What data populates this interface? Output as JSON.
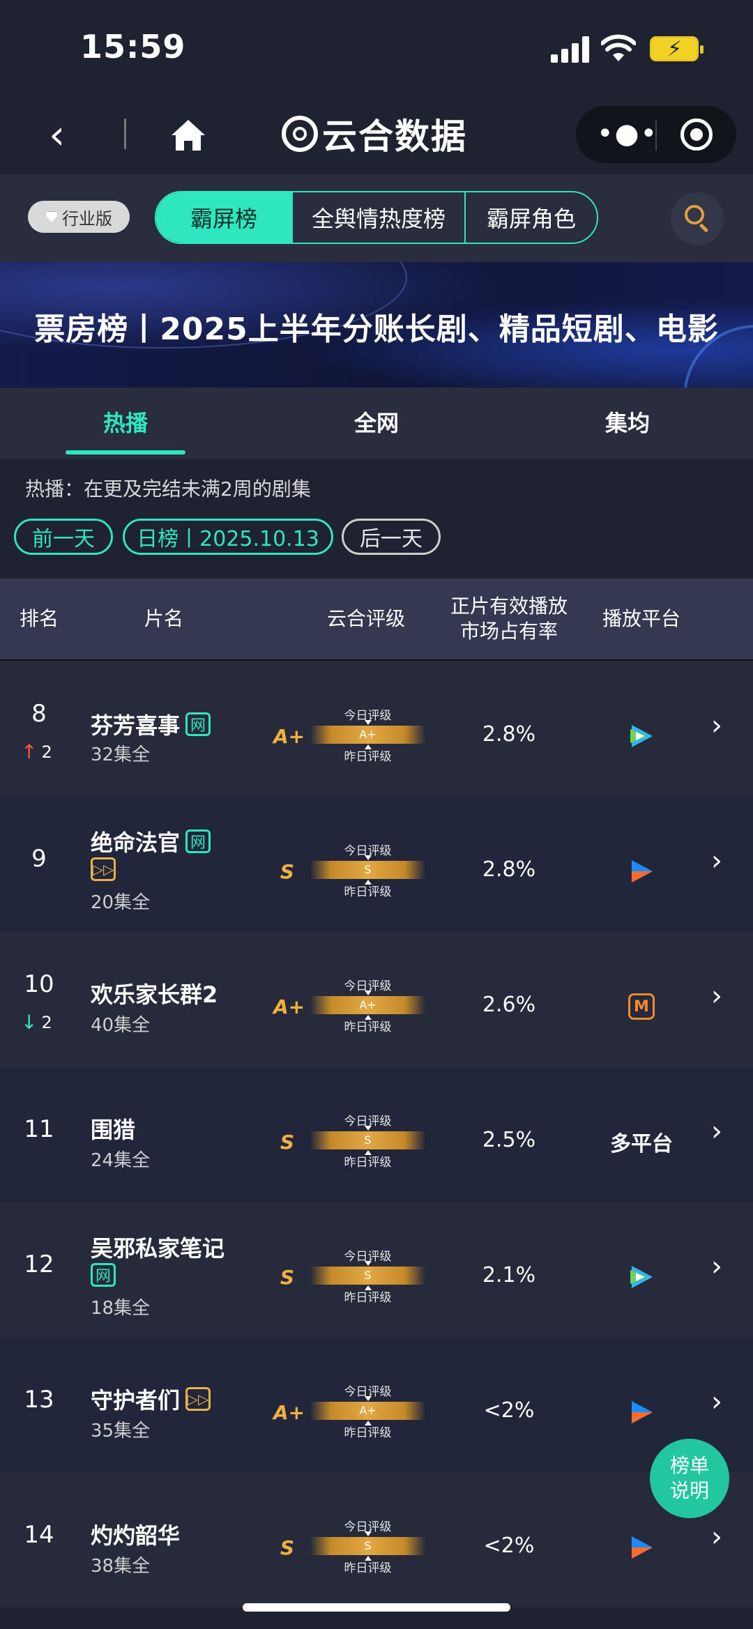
{
  "status_bar": {
    "time": "15:59"
  },
  "nav": {
    "brand": "云合数据"
  },
  "top_tabs": {
    "badge": "行业版",
    "tabs": [
      {
        "label": "霸屏榜",
        "active": true
      },
      {
        "label": "全舆情热度榜",
        "active": false
      },
      {
        "label": "霸屏角色",
        "active": false
      }
    ]
  },
  "banner": {
    "title": "票房榜丨2025上半年分账长剧、精品短剧、电影"
  },
  "sub_tabs": [
    {
      "label": "热播",
      "active": true
    },
    {
      "label": "全网",
      "active": false
    },
    {
      "label": "集均",
      "active": false
    }
  ],
  "description": "热播：在更及完结未满2周的剧集",
  "date_nav": {
    "prev": "前一天",
    "current": "日榜丨2025.10.13",
    "next": "后一天"
  },
  "table": {
    "headers": {
      "rank": "排名",
      "title": "片名",
      "grade": "云合评级",
      "share_line1": "正片有效播放",
      "share_line2": "市场占有率",
      "platform": "播放平台"
    },
    "gauge_labels": {
      "today": "今日评级",
      "yesterday": "昨日评级"
    },
    "rows": [
      {
        "rank": "8",
        "trend": "up",
        "trend_value": "2",
        "title": "芬芳喜事",
        "tags": [
          "网"
        ],
        "episodes": "32集全",
        "grade": "A+",
        "share": "2.8%",
        "platform": "tencent-icon"
      },
      {
        "rank": "9",
        "trend": "",
        "trend_value": "",
        "title": "绝命法官",
        "tags": [
          "网",
          "▷▷"
        ],
        "episodes": "20集全",
        "grade": "S",
        "share": "2.8%",
        "platform": "youku-icon"
      },
      {
        "rank": "10",
        "trend": "down",
        "trend_value": "2",
        "title": "欢乐家长群2",
        "tags": [],
        "episodes": "40集全",
        "grade": "A+",
        "share": "2.6%",
        "platform": "mango-icon"
      },
      {
        "rank": "11",
        "trend": "",
        "trend_value": "",
        "title": "围猎",
        "tags": [],
        "episodes": "24集全",
        "grade": "S",
        "share": "2.5%",
        "platform_text": "多平台"
      },
      {
        "rank": "12",
        "trend": "",
        "trend_value": "",
        "title": "吴邪私家笔记",
        "tags": [
          "网"
        ],
        "episodes": "18集全",
        "grade": "S",
        "share": "2.1%",
        "platform": "tencent-icon"
      },
      {
        "rank": "13",
        "trend": "",
        "trend_value": "",
        "title": "守护者们",
        "tags": [
          "▷▷"
        ],
        "episodes": "35集全",
        "grade": "A+",
        "share": "<2%",
        "platform": "youku-icon"
      },
      {
        "rank": "14",
        "trend": "",
        "trend_value": "",
        "title": "灼灼韶华",
        "tags": [],
        "episodes": "38集全",
        "grade": "S",
        "share": "<2%",
        "platform": "youku-icon"
      }
    ]
  },
  "fab": {
    "line1": "榜单",
    "line2": "说明"
  },
  "colors": {
    "accent": "#2ee6c0",
    "grade": "#f0b13e",
    "background": "#1f2230"
  }
}
